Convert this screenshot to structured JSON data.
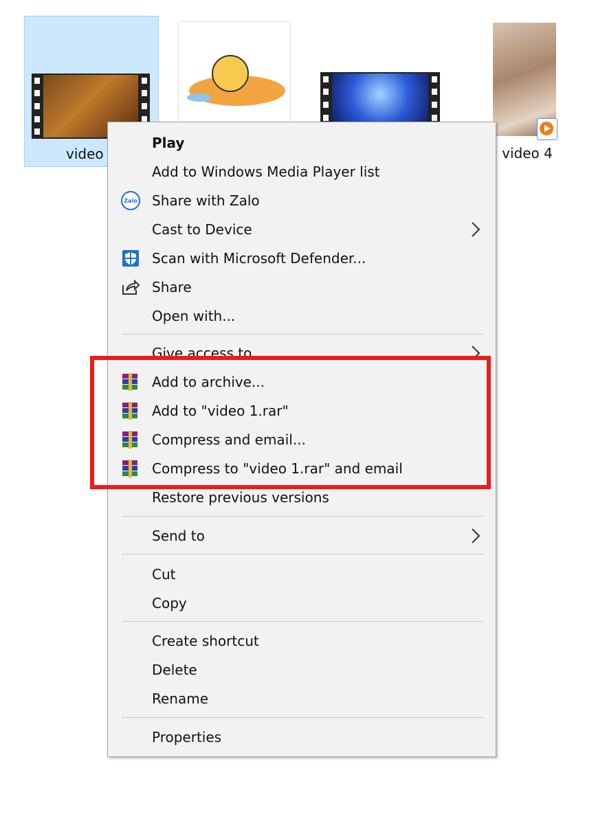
{
  "files": [
    {
      "label": "video",
      "selected": true
    },
    {
      "label": "",
      "selected": false
    },
    {
      "label": "",
      "selected": false
    },
    {
      "label": "video 4",
      "selected": false
    }
  ],
  "menu": {
    "play": "Play",
    "add_wmp": "Add to Windows Media Player list",
    "share_zalo": "Share with Zalo",
    "zalo_badge": "Zalo",
    "cast": "Cast to Device",
    "scan": "Scan with Microsoft Defender...",
    "share": "Share",
    "open_with": "Open with...",
    "give_access": "Give access to",
    "add_archive": "Add to archive...",
    "add_rar": "Add to \"video 1.rar\"",
    "compress_email": "Compress and email...",
    "compress_rar_email": "Compress to \"video 1.rar\" and email",
    "restore": "Restore previous versions",
    "send_to": "Send to",
    "cut": "Cut",
    "copy": "Copy",
    "create_shortcut": "Create shortcut",
    "delete": "Delete",
    "rename": "Rename",
    "properties": "Properties"
  },
  "colors": {
    "highlight_border": "#ee1b1b",
    "selection_bg": "#cce8ff",
    "menu_bg": "#f2f2f2",
    "defender_blue": "#1e74c9",
    "zalo_blue": "#1a6df0"
  },
  "icons": [
    "zalo-icon",
    "defender-shield-icon",
    "share-icon",
    "winrar-icon",
    "chevron-right-icon",
    "media-player-badge-icon"
  ]
}
